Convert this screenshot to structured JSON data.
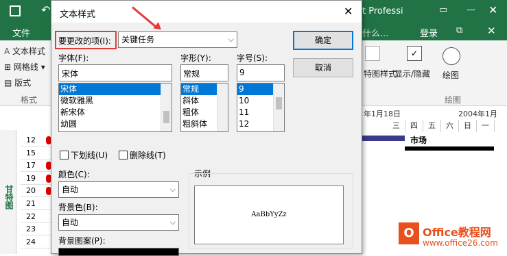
{
  "app": {
    "title_fragment": "t Professi",
    "login": "登录",
    "file_tab": "文件",
    "ribbon_mid_text": "什么...",
    "ribbon_left": {
      "text_style": "文本样式",
      "gridlines": "网格线",
      "layout": "版式",
      "group": "格式"
    },
    "ribbon_right": {
      "gantt_style": "特图样式",
      "show_hide": "显示/隐藏",
      "drawing": "绘图",
      "drawing_group": "绘图"
    },
    "row_numbers": [
      "12",
      "15",
      "17",
      "19",
      "20",
      "21",
      "22",
      "23",
      "24"
    ],
    "row_pins": [
      true,
      false,
      true,
      true,
      true,
      false,
      false,
      false,
      false
    ],
    "vertical_tab": "甘特图",
    "timeline": {
      "date1": "年1月18日",
      "date2": "2004年1月",
      "days": [
        "三",
        "四",
        "五",
        "六",
        "日",
        "一"
      ],
      "task_label": "市场"
    },
    "watermark": {
      "brand": "Office教程网",
      "url": "www.office26.com"
    }
  },
  "dialog": {
    "title": "文本样式",
    "item_to_change_label": "要更改的项(I):",
    "item_to_change_value": "关键任务",
    "ok": "确定",
    "cancel": "取消",
    "font_label": "字体(F):",
    "font_value": "宋体",
    "font_list": [
      "宋体",
      "微软雅黑",
      "新宋体",
      "幼圆"
    ],
    "style_label": "字形(Y):",
    "style_value": "常规",
    "style_list": [
      "常规",
      "斜体",
      "粗体",
      "粗斜体"
    ],
    "size_label": "字号(S):",
    "size_value": "9",
    "size_list": [
      "9",
      "10",
      "11",
      "12"
    ],
    "underline": "下划线(U)",
    "strikethrough": "删除线(T)",
    "color_label": "颜色(C):",
    "color_value": "自动",
    "bg_color_label": "背景色(B):",
    "bg_color_value": "自动",
    "bg_pattern_label": "背景图案(P):",
    "sample_label": "示例",
    "sample_text": "AaBbYyZz"
  }
}
